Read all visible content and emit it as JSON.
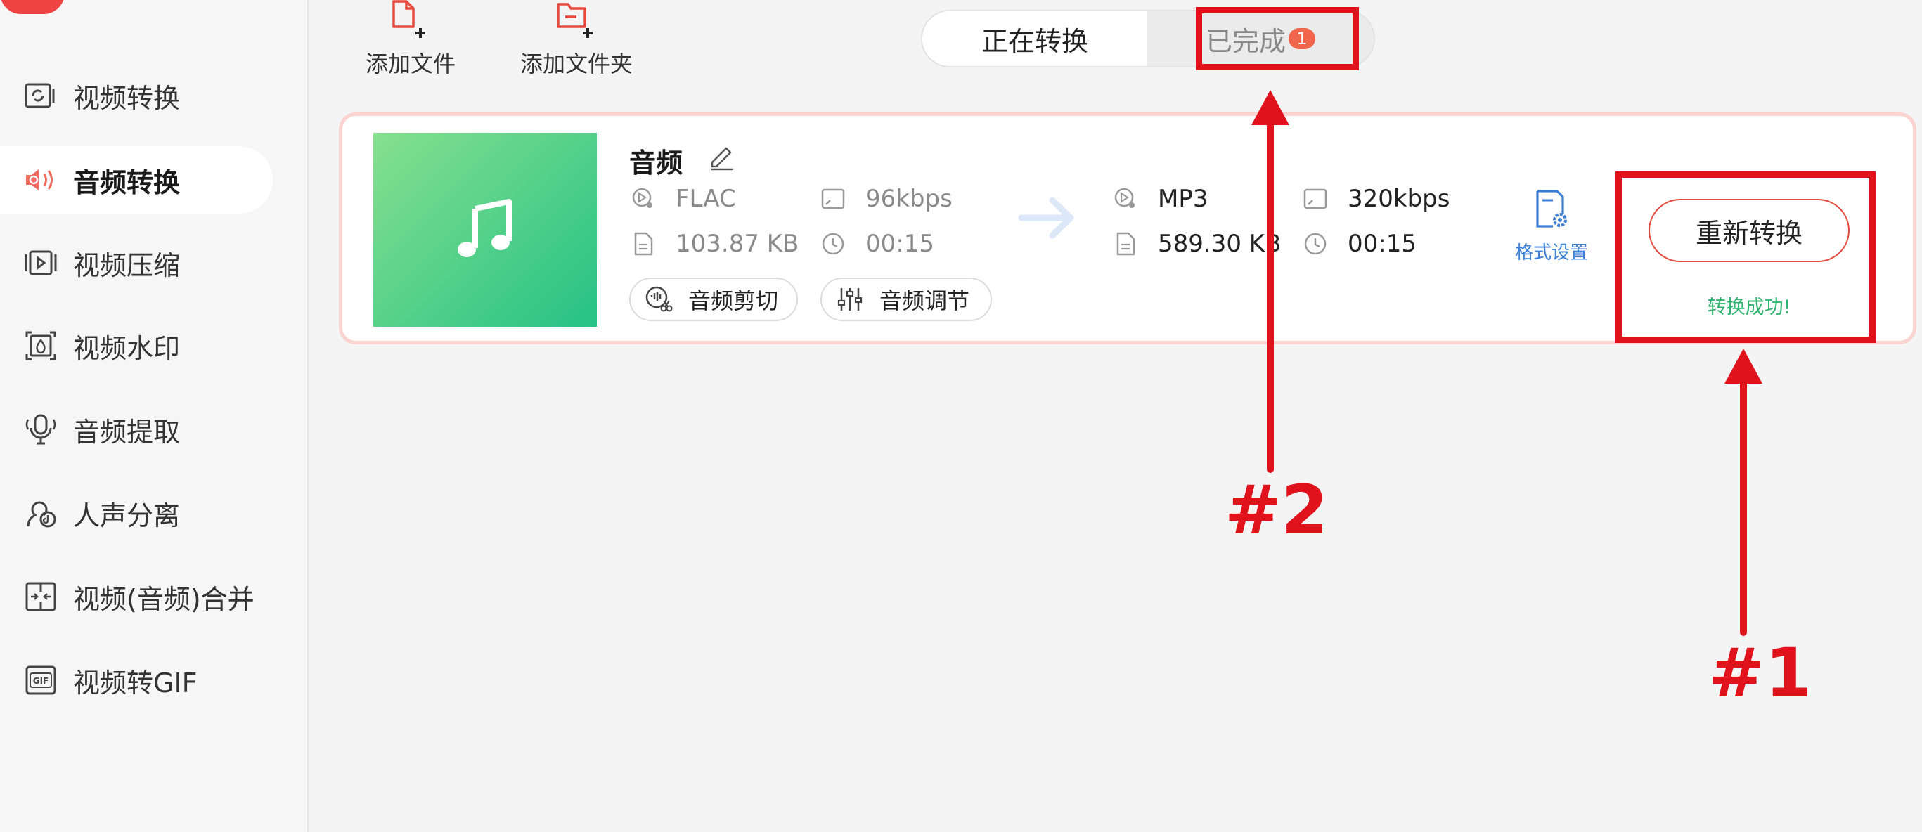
{
  "sidebar": {
    "items": [
      {
        "label": "视频转换",
        "icon": "video-convert-icon",
        "active": false
      },
      {
        "label": "音频转换",
        "icon": "audio-convert-icon",
        "active": true
      },
      {
        "label": "视频压缩",
        "icon": "video-compress-icon",
        "active": false
      },
      {
        "label": "视频水印",
        "icon": "video-watermark-icon",
        "active": false
      },
      {
        "label": "音频提取",
        "icon": "audio-extract-icon",
        "active": false
      },
      {
        "label": "人声分离",
        "icon": "vocal-separate-icon",
        "active": false
      },
      {
        "label": "视频(音频)合并",
        "icon": "merge-icon",
        "active": false
      },
      {
        "label": "视频转GIF",
        "icon": "gif-icon",
        "active": false
      }
    ]
  },
  "toolbar": {
    "add_file": "添加文件",
    "add_folder": "添加文件夹"
  },
  "tabs": {
    "converting": "正在转换",
    "done": "已完成",
    "done_badge": "1"
  },
  "file": {
    "title": "音频",
    "source": {
      "format": "FLAC",
      "bitrate": "96kbps",
      "size": "103.87 KB",
      "duration": "00:15"
    },
    "output": {
      "format": "MP3",
      "bitrate": "320kbps",
      "size": "589.30 KB",
      "duration": "00:15"
    },
    "actions": {
      "cut": "音频剪切",
      "adjust": "音频调节"
    },
    "format_settings": "格式设置",
    "reconvert": "重新转换",
    "status": "转换成功!"
  },
  "annotations": {
    "label_1": "#1",
    "label_2": "#2"
  },
  "colors": {
    "accent": "#e64b40",
    "annotation": "#e0131d",
    "success": "#2fb36f",
    "link": "#3c7fd6",
    "thumb_start": "#86e08f",
    "thumb_end": "#25c285"
  }
}
